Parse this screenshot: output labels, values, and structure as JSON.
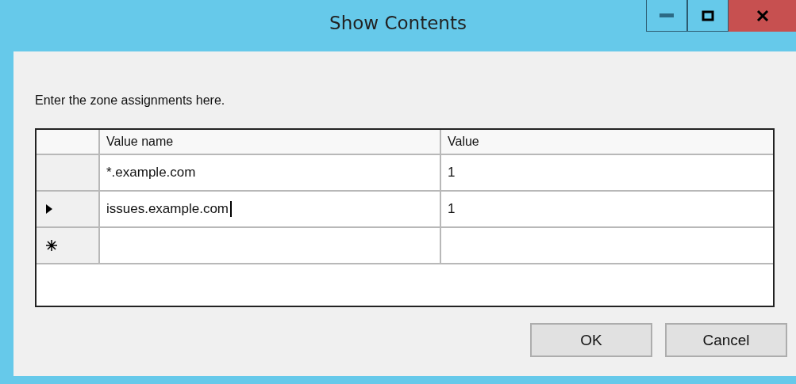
{
  "window": {
    "title": "Show Contents"
  },
  "instructions": "Enter the zone assignments here.",
  "table": {
    "columns": [
      "Value name",
      "Value"
    ],
    "rows": [
      {
        "kind": "data",
        "editing": false,
        "cells": [
          "*.example.com",
          "1"
        ]
      },
      {
        "kind": "current",
        "editing": true,
        "cells": [
          "issues.example.com",
          "1"
        ]
      },
      {
        "kind": "new",
        "cells": []
      }
    ]
  },
  "buttons": [
    {
      "label": "OK"
    },
    {
      "label": "Cancel"
    }
  ]
}
